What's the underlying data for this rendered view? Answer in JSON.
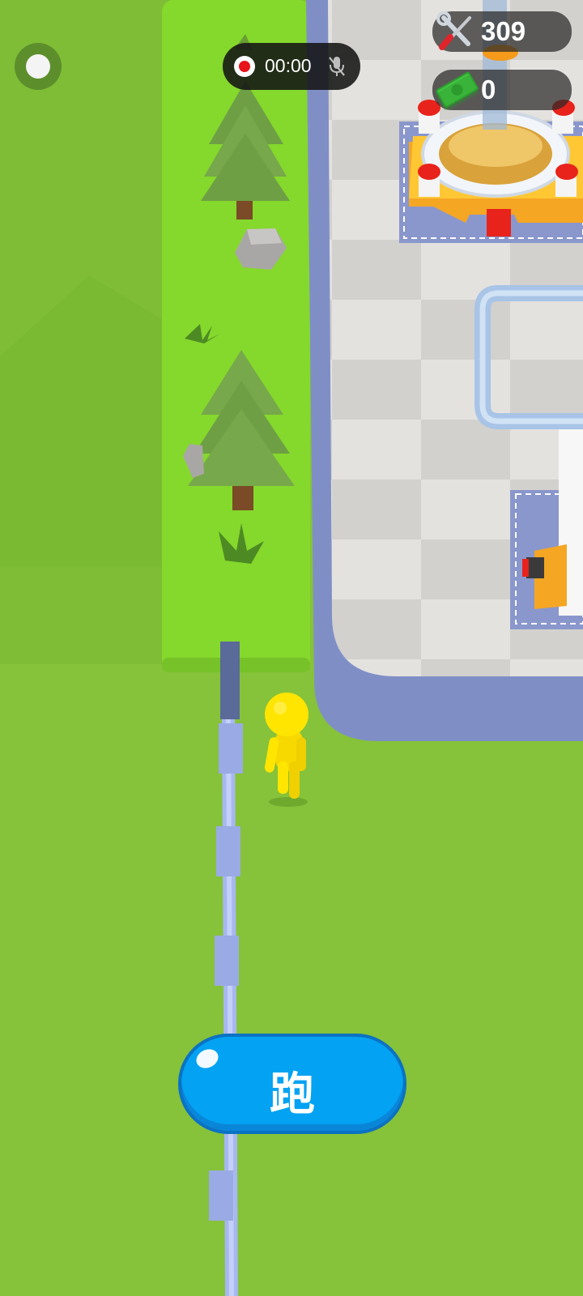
{
  "hud": {
    "tools_count": "309",
    "cash_count": "0",
    "tools_icon": "wrench-screwdriver-icon",
    "cash_icon": "banknote-icon"
  },
  "recorder": {
    "time": "00:00",
    "record_icon": "record-dot-icon",
    "mic_icon": "mic-muted-icon"
  },
  "controls": {
    "run_label": "跑"
  },
  "colors": {
    "grass": "#86c23a",
    "grass_path": "#85d82c",
    "floor_light": "#e4e2df",
    "floor_dark": "#d2d0cd",
    "wall": "#7a8bc2",
    "button": "#03a2f2",
    "character": "#ffe500"
  }
}
